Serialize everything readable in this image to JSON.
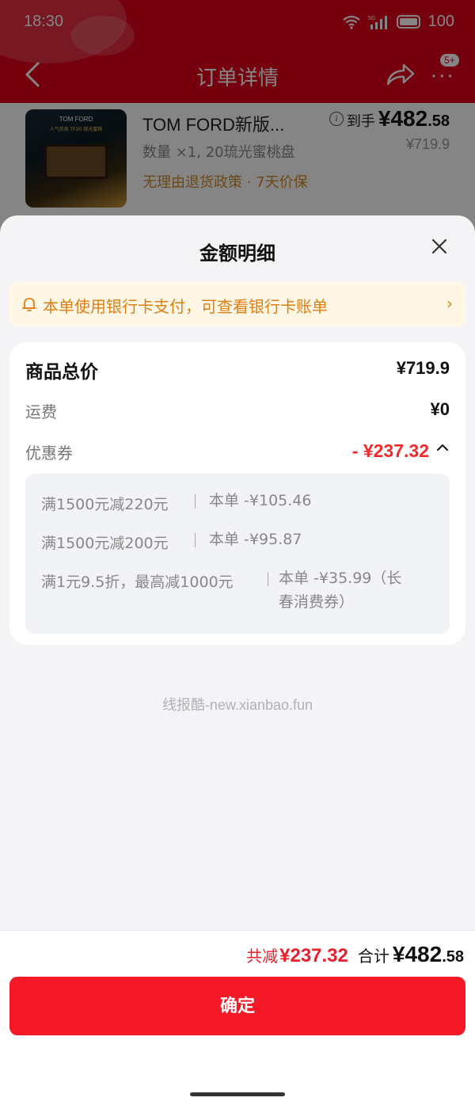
{
  "status_bar": {
    "time": "18:30",
    "network": "5G",
    "battery": "100"
  },
  "nav": {
    "title": "订单详情",
    "badge": "5+"
  },
  "product": {
    "image_brand": "TOM FORD",
    "image_caption": "人气热卖 TF20 琉光蜜桃",
    "name": "TOM FORD新版...",
    "spec": "数量 ×1, 20琉光蜜桃盘",
    "policy": "无理由退货政策 · 7天价保",
    "price_label": "到手",
    "price_int": "¥482",
    "price_dec": ".58",
    "original_price": "¥719.9"
  },
  "sheet": {
    "title": "金额明细",
    "notice": "本单使用银行卡支付，可查看银行卡账单",
    "notice_arrow": "›",
    "total_label": "商品总价",
    "total_value": "¥719.9",
    "shipping_label": "运费",
    "shipping_value": "¥0",
    "coupon_label": "优惠券",
    "coupon_value": "- ¥237.32",
    "coupons": [
      {
        "rule": "满1500元减220元",
        "detail": "本单 -¥105.46"
      },
      {
        "rule": "满1500元减200元",
        "detail": "本单 -¥95.87"
      },
      {
        "rule": "满1元9.5折，最高减1000元",
        "detail_line1": "本单 -¥35.99（长",
        "detail_line2": "春消费券）"
      }
    ]
  },
  "watermark": "线报酷-new.xianbao.fun",
  "footer": {
    "reduce_label": "共减",
    "reduce_value": "¥237.32",
    "total_label": "合计",
    "total_int": "¥482",
    "total_dec": ".58",
    "confirm_label": "确定"
  },
  "colors": {
    "brand_red": "#e0001c",
    "accent_red": "#f51827",
    "notice_orange": "#e07e12"
  }
}
